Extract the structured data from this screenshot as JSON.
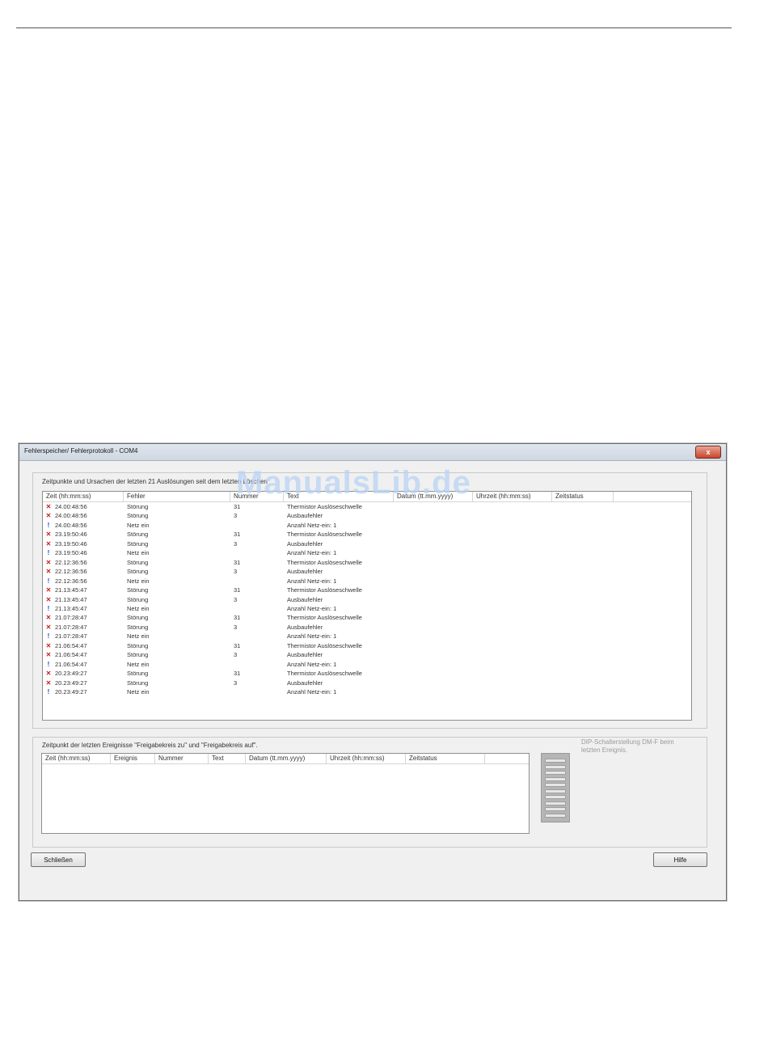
{
  "window": {
    "title": "Fehlerspeicher/ Fehlerprotokoll - COM4",
    "close_label": "x"
  },
  "watermark": "ManualsLib.de",
  "group1": {
    "title": "Zeitpunkte und Ursachen der letzten 21 Auslösungen seit dem letzten Löschen",
    "columns": [
      "Zeit (hh:mm:ss)",
      "Fehler",
      "Nummer",
      "Text",
      "Datum (tt.mm.yyyy)",
      "Uhrzeit (hh:mm:ss)",
      "Zeitstatus"
    ],
    "rows": [
      {
        "icon": "error-icon",
        "time": "24.00:48:56",
        "fault": "Störung",
        "number": "31",
        "text": "Thermistor Auslöseschwelle"
      },
      {
        "icon": "error-icon",
        "time": "24.00:48:56",
        "fault": "Störung",
        "number": "3",
        "text": "Ausbaufehler"
      },
      {
        "icon": "info-icon",
        "time": "24.00:48:56",
        "fault": "Netz ein",
        "number": "",
        "text": "Anzahl Netz-ein: 1"
      },
      {
        "icon": "error-icon",
        "time": "23.19:50:46",
        "fault": "Störung",
        "number": "31",
        "text": "Thermistor Auslöseschwelle"
      },
      {
        "icon": "error-icon",
        "time": "23.19:50:46",
        "fault": "Störung",
        "number": "3",
        "text": "Ausbaufehler"
      },
      {
        "icon": "info-icon",
        "time": "23.19:50:46",
        "fault": "Netz ein",
        "number": "",
        "text": "Anzahl Netz-ein: 1"
      },
      {
        "icon": "error-icon",
        "time": "22.12:36:56",
        "fault": "Störung",
        "number": "31",
        "text": "Thermistor Auslöseschwelle"
      },
      {
        "icon": "error-icon",
        "time": "22.12:36:56",
        "fault": "Störung",
        "number": "3",
        "text": "Ausbaufehler"
      },
      {
        "icon": "info-icon",
        "time": "22.12:36:56",
        "fault": "Netz ein",
        "number": "",
        "text": "Anzahl Netz-ein: 1"
      },
      {
        "icon": "error-icon",
        "time": "21.13:45:47",
        "fault": "Störung",
        "number": "31",
        "text": "Thermistor Auslöseschwelle"
      },
      {
        "icon": "error-icon",
        "time": "21.13:45:47",
        "fault": "Störung",
        "number": "3",
        "text": "Ausbaufehler"
      },
      {
        "icon": "info-icon",
        "time": "21.13:45:47",
        "fault": "Netz ein",
        "number": "",
        "text": "Anzahl Netz-ein: 1"
      },
      {
        "icon": "error-icon",
        "time": "21.07:28:47",
        "fault": "Störung",
        "number": "31",
        "text": "Thermistor Auslöseschwelle"
      },
      {
        "icon": "error-icon",
        "time": "21.07:28:47",
        "fault": "Störung",
        "number": "3",
        "text": "Ausbaufehler"
      },
      {
        "icon": "info-icon",
        "time": "21.07:28:47",
        "fault": "Netz ein",
        "number": "",
        "text": "Anzahl Netz-ein: 1"
      },
      {
        "icon": "error-icon",
        "time": "21.06:54:47",
        "fault": "Störung",
        "number": "31",
        "text": "Thermistor Auslöseschwelle"
      },
      {
        "icon": "error-icon",
        "time": "21.06:54:47",
        "fault": "Störung",
        "number": "3",
        "text": "Ausbaufehler"
      },
      {
        "icon": "info-icon",
        "time": "21.06:54:47",
        "fault": "Netz ein",
        "number": "",
        "text": "Anzahl Netz-ein: 1"
      },
      {
        "icon": "error-icon",
        "time": "20.23:49:27",
        "fault": "Störung",
        "number": "31",
        "text": "Thermistor Auslöseschwelle"
      },
      {
        "icon": "error-icon",
        "time": "20.23:49:27",
        "fault": "Störung",
        "number": "3",
        "text": "Ausbaufehler"
      },
      {
        "icon": "info-icon",
        "time": "20.23:49:27",
        "fault": "Netz ein",
        "number": "",
        "text": "Anzahl Netz-ein: 1"
      }
    ]
  },
  "group2": {
    "title": "Zeitpunkt der letzten Ereignisse \"Freigabekreis zu\" und \"Freigabekreis auf\".",
    "columns": [
      "Zeit (hh:mm:ss)",
      "Ereignis",
      "Nummer",
      "Text",
      "Datum (tt.mm.yyyy)",
      "Uhrzeit (hh:mm:ss)",
      "Zeitstatus"
    ],
    "dip_text": "DIP-Schalterstellung DM-F beim letzten Ereignis."
  },
  "buttons": {
    "close_label": "Schließen",
    "help_label": "Hilfe"
  },
  "colors": {
    "error_icon": "#cc1f1f",
    "info_icon": "#1f3fcc"
  }
}
